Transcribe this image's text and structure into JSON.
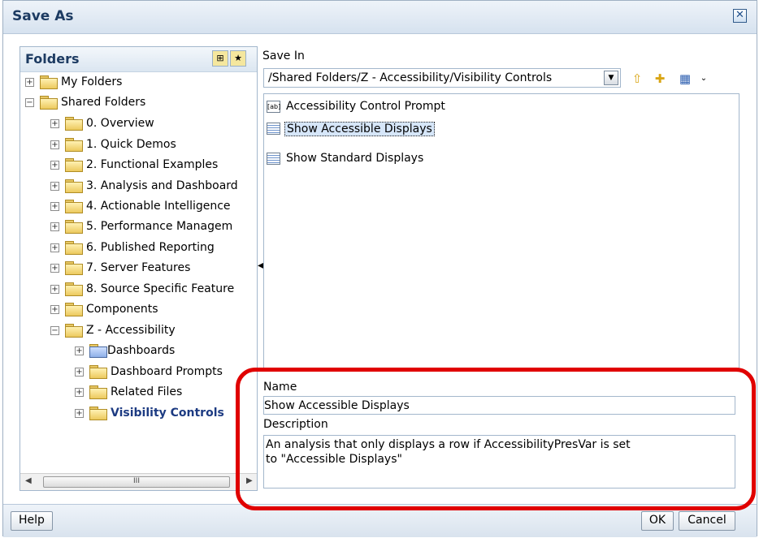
{
  "dialog": {
    "title": "Save As"
  },
  "folders": {
    "title": "Folders",
    "tree": [
      {
        "label": "My Folders",
        "expander": "+",
        "level": 0,
        "kind": "folder"
      },
      {
        "label": "Shared Folders",
        "expander": "−",
        "level": 0,
        "kind": "folder-open"
      },
      {
        "label": "0. Overview",
        "expander": "+",
        "level": 1,
        "kind": "folder"
      },
      {
        "label": "1. Quick Demos",
        "expander": "+",
        "level": 1,
        "kind": "folder"
      },
      {
        "label": "2. Functional Examples",
        "expander": "+",
        "level": 1,
        "kind": "folder"
      },
      {
        "label": "3. Analysis and Dashboard",
        "expander": "+",
        "level": 1,
        "kind": "folder"
      },
      {
        "label": "4. Actionable Intelligence",
        "expander": "+",
        "level": 1,
        "kind": "folder"
      },
      {
        "label": "5. Performance Managem",
        "expander": "+",
        "level": 1,
        "kind": "folder"
      },
      {
        "label": "6. Published Reporting",
        "expander": "+",
        "level": 1,
        "kind": "folder"
      },
      {
        "label": "7. Server Features",
        "expander": "+",
        "level": 1,
        "kind": "folder"
      },
      {
        "label": "8. Source Specific Feature",
        "expander": "+",
        "level": 1,
        "kind": "folder"
      },
      {
        "label": "Components",
        "expander": "+",
        "level": 1,
        "kind": "folder"
      },
      {
        "label": "Z - Accessibility",
        "expander": "−",
        "level": 1,
        "kind": "folder-open"
      },
      {
        "label": "Dashboards",
        "expander": "+",
        "level": 2,
        "kind": "dashboard"
      },
      {
        "label": "Dashboard Prompts",
        "expander": "+",
        "level": 2,
        "kind": "folder"
      },
      {
        "label": "Related Files",
        "expander": "+",
        "level": 2,
        "kind": "folder"
      },
      {
        "label": "Visibility Controls",
        "expander": "+",
        "level": 2,
        "kind": "folder",
        "selected": true
      }
    ],
    "scrollbar_grip": "III"
  },
  "save_in": {
    "label": "Save In",
    "path": "/Shared Folders/Z - Accessibility/Visibility Controls",
    "toolbar_icons": [
      "up-folder-icon",
      "new-folder-icon",
      "view-mode-icon"
    ]
  },
  "files": [
    {
      "label": "Accessibility Control Prompt",
      "icon": "prompt-icon",
      "icon_text": "[ab]",
      "selected": false
    },
    {
      "label": "Show Accessible Displays",
      "icon": "analysis-icon",
      "selected": true
    },
    {
      "label": "Show Standard Displays",
      "icon": "analysis-icon",
      "selected": false
    }
  ],
  "name_field": {
    "label": "Name",
    "value": "Show Accessible Displays"
  },
  "description_field": {
    "label": "Description",
    "line1": "An analysis that only displays a row if AccessibilityPresVar is set",
    "line2": "to \"Accessible Displays\""
  },
  "buttons": {
    "help": "Help",
    "ok": "OK",
    "cancel": "Cancel"
  },
  "colors": {
    "highlight": "#e00000",
    "title": "#1d3b62",
    "selected_text": "#1d3b82"
  }
}
